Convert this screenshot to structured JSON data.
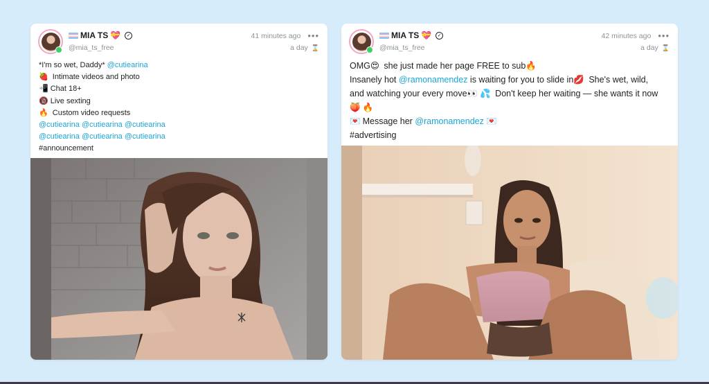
{
  "posts": [
    {
      "author": {
        "name": "MIA TS",
        "handle": "@mia_ts_free"
      },
      "time_ago": "41 minutes ago",
      "expires": "a day",
      "lines": [
        [
          {
            "t": "*I'm so wet, Daddy* "
          },
          {
            "t": "@cutiearina",
            "m": true
          }
        ],
        [
          {
            "e": "🍓"
          },
          {
            "t": " Intimate videos and photo"
          }
        ],
        [
          {
            "e": "📲"
          },
          {
            "t": "Chat 18+"
          }
        ],
        [
          {
            "e": "🔞"
          },
          {
            "t": "Live sexting"
          }
        ],
        [
          {
            "e": "🔥"
          },
          {
            "t": " Custom video requests"
          }
        ],
        [
          {
            "t": "@cutiearina",
            "m": true
          },
          {
            "t": " "
          },
          {
            "t": "@cutiearina",
            "m": true
          },
          {
            "t": " "
          },
          {
            "t": "@cutiearina",
            "m": true
          }
        ],
        [
          {
            "t": "@cutiearina",
            "m": true
          },
          {
            "t": " "
          },
          {
            "t": "@cutiearina",
            "m": true
          },
          {
            "t": " "
          },
          {
            "t": "@cutiearina",
            "m": true
          }
        ],
        [
          {
            "t": "#announcement"
          }
        ]
      ],
      "image_alt": "Portrait photo of a young woman with long brown hair against a brick wall"
    },
    {
      "author": {
        "name": "MIA TS",
        "handle": "@mia_ts_free"
      },
      "time_ago": "42 minutes ago",
      "expires": "a day",
      "lines": [
        [
          {
            "t": "OMG"
          },
          {
            "e": "😍"
          },
          {
            "t": " she just made her page FREE to sub"
          },
          {
            "e": "🔥"
          }
        ],
        [
          {
            "t": "Insanely hot "
          },
          {
            "t": "@ramonamendez",
            "m": true
          },
          {
            "t": " is waiting for you to slide in"
          },
          {
            "e": "💋"
          },
          {
            "t": " She's wet, wild,"
          }
        ],
        [
          {
            "t": "and watching your every move"
          },
          {
            "e": "👀"
          },
          {
            "e": "💦"
          },
          {
            "t": " Don't keep her waiting — she wants it now"
          }
        ],
        [
          {
            "e": "🍑"
          },
          {
            "e": "🔥"
          }
        ],
        [
          {
            "e": "💌"
          },
          {
            "t": "Message her "
          },
          {
            "t": "@ramonamendez",
            "m": true
          },
          {
            "t": " "
          },
          {
            "e": "💌"
          }
        ],
        [
          {
            "t": "#advertising"
          }
        ]
      ],
      "image_alt": "Photo of a woman in a pink top seated in a beige chair"
    }
  ],
  "colors": {
    "background": "#d7ecfb",
    "mention": "#1aa5d6",
    "muted": "#8b949a"
  },
  "icons": [
    "trans-flag-icon",
    "heart-icon",
    "verified-icon",
    "more-icon",
    "hourglass-icon"
  ]
}
